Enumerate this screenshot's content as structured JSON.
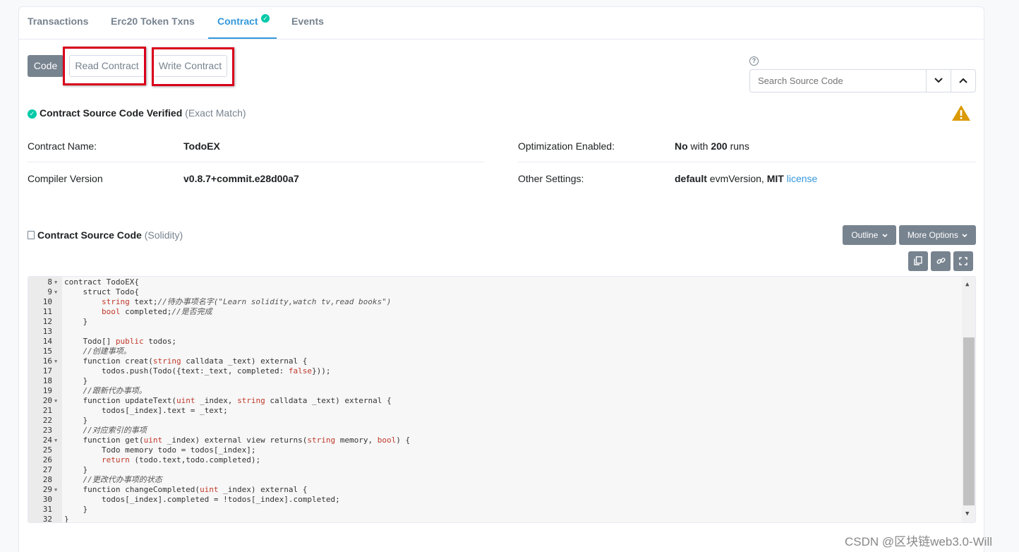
{
  "tabs": [
    {
      "label": "Transactions"
    },
    {
      "label": "Erc20 Token Txns"
    },
    {
      "label": "Contract"
    },
    {
      "label": "Events"
    }
  ],
  "sub_buttons": {
    "code": "Code",
    "read": "Read Contract",
    "write": "Write Contract"
  },
  "search": {
    "placeholder": "Search Source Code",
    "help": "?"
  },
  "verified": {
    "title": "Contract Source Code Verified",
    "match": "(Exact Match)"
  },
  "info": {
    "contract_name_label": "Contract Name:",
    "contract_name": "TodoEX",
    "compiler_label": "Compiler Version",
    "compiler": "v0.8.7+commit.e28d00a7",
    "optimization_label": "Optimization Enabled:",
    "optimization_no": "No",
    "optimization_with": " with ",
    "optimization_runs": "200",
    "optimization_runs_suffix": " runs",
    "other_label": "Other Settings:",
    "other_default": "default",
    "other_evm": " evmVersion, ",
    "other_mit": "MIT",
    "other_license": "license"
  },
  "source": {
    "title": "Contract Source Code",
    "lang": "(Solidity)",
    "outline": "Outline",
    "more": "More Options"
  },
  "code_lines": [
    {
      "n": "8",
      "fold": true,
      "text": "contract TodoEX{"
    },
    {
      "n": "9",
      "fold": true,
      "text": "    struct Todo{"
    },
    {
      "n": "10",
      "fold": false,
      "text": "        string text;//待办事项名字(\"Learn solidity,watch tv,read books\")"
    },
    {
      "n": "11",
      "fold": false,
      "text": "        bool completed;//是否完成"
    },
    {
      "n": "12",
      "fold": false,
      "text": "    }"
    },
    {
      "n": "13",
      "fold": false,
      "text": ""
    },
    {
      "n": "14",
      "fold": false,
      "text": "    Todo[] public todos;"
    },
    {
      "n": "15",
      "fold": false,
      "text": "    //创建事项。"
    },
    {
      "n": "16",
      "fold": true,
      "text": "    function creat(string calldata _text) external {"
    },
    {
      "n": "17",
      "fold": false,
      "text": "        todos.push(Todo({text:_text, completed: false}));"
    },
    {
      "n": "18",
      "fold": false,
      "text": "    }"
    },
    {
      "n": "19",
      "fold": false,
      "text": "    //跟新代办事项。"
    },
    {
      "n": "20",
      "fold": true,
      "text": "    function updateText(uint _index, string calldata _text) external {"
    },
    {
      "n": "21",
      "fold": false,
      "text": "        todos[_index].text = _text;"
    },
    {
      "n": "22",
      "fold": false,
      "text": "    }"
    },
    {
      "n": "23",
      "fold": false,
      "text": "    //对应索引的事项"
    },
    {
      "n": "24",
      "fold": true,
      "text": "    function get(uint _index) external view returns(string memory, bool) {"
    },
    {
      "n": "25",
      "fold": false,
      "text": "        Todo memory todo = todos[_index];"
    },
    {
      "n": "26",
      "fold": false,
      "text": "        return (todo.text,todo.completed);"
    },
    {
      "n": "27",
      "fold": false,
      "text": "    }"
    },
    {
      "n": "28",
      "fold": false,
      "text": "    //更改代办事项的状态"
    },
    {
      "n": "29",
      "fold": true,
      "text": "    function changeCompleted(uint _index) external {"
    },
    {
      "n": "30",
      "fold": false,
      "text": "        todos[_index].completed = !todos[_index].completed;"
    },
    {
      "n": "31",
      "fold": false,
      "text": "    }"
    },
    {
      "n": "32",
      "fold": false,
      "text": "}"
    }
  ],
  "watermark": "CSDN @区块链web3.0-Will",
  "colors": {
    "accent": "#3498db",
    "verified": "#00c9a7",
    "button": "#77838f",
    "highlight": "#d9001b",
    "warning": "#db9a04"
  }
}
